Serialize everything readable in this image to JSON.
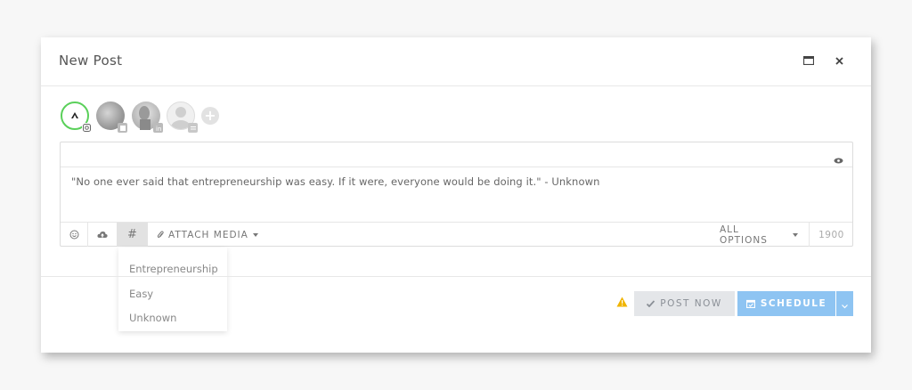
{
  "modal": {
    "title": "New Post"
  },
  "header": {
    "maximize_icon": "window-maximize-icon",
    "close_icon": "close-icon"
  },
  "accounts": [
    {
      "name": "account-1",
      "network": "instagram",
      "selected": true
    },
    {
      "name": "account-2",
      "network": "twitter",
      "selected": false
    },
    {
      "name": "account-3",
      "network": "linkedin",
      "selected": false
    },
    {
      "name": "account-4",
      "network": "other",
      "selected": false
    }
  ],
  "editor": {
    "text": "\"No one ever said that entrepreneurship was easy. If it were, everyone would be doing it.\" - Unknown",
    "preview_icon": "eye-icon"
  },
  "toolbar": {
    "emoji_icon": "smiley-icon",
    "upload_icon": "cloud-upload-icon",
    "hashtag_label": "#",
    "attach_label": "ATTACH MEDIA",
    "alloptions_label": "ALL OPTIONS",
    "char_count": "1900"
  },
  "hashtag_suggestions": [
    "Entrepreneurship",
    "Easy",
    "Unknown"
  ],
  "footer": {
    "post_now_label": "POST NOW",
    "schedule_label": "SCHEDULE"
  },
  "colors": {
    "accent": "#8ec4f2",
    "selected_border": "#5ad05a",
    "warning": "#f0b400"
  }
}
